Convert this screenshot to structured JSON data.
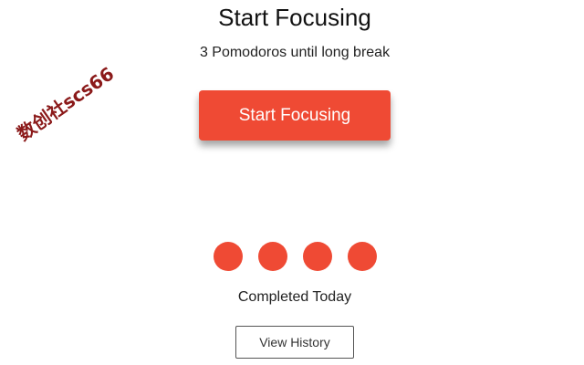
{
  "header": {
    "title": "Start Focusing",
    "subtitle": "3 Pomodoros until long break"
  },
  "actions": {
    "start_label": "Start Focusing",
    "history_label": "View History"
  },
  "progress": {
    "completed_today_count": 4,
    "completed_label": "Completed Today"
  },
  "watermark": {
    "text": "数创社scs66"
  },
  "colors": {
    "accent": "#ef4a34",
    "watermark": "#8b1a1a",
    "text": "#1c1c1c"
  }
}
